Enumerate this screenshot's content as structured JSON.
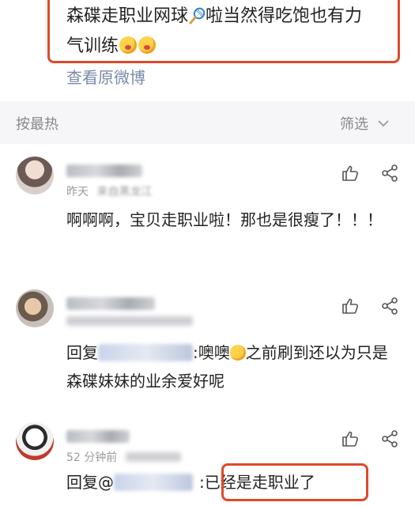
{
  "post": {
    "text_part1": "森碟走职业网球",
    "text_part2": "啦当然得吃饱也有力",
    "text_part3": "气训练",
    "racket_icon": "tennis-racket-icon",
    "emoji_icon": "drooling-face-icon"
  },
  "view_original": "查看原微博",
  "sort_bar": {
    "sort_label": "按最热",
    "filter_label": "筛选"
  },
  "comments": [
    {
      "meta_time": "昨天",
      "meta_suffix": "来自黑龙江",
      "text": "啊啊啊，宝贝走职业啦！那也是很瘦了！！！"
    },
    {
      "reply_prefix": "回复",
      "text_after": ":噢噢",
      "text_end": "之前刷到还以为只是森碟妹妹的业余爱好呢"
    },
    {
      "meta_time": "52 分钟前",
      "reply_prefix": "回复@",
      "text_after": ":已经是走职业了"
    }
  ],
  "colors": {
    "highlight": "#e0492a",
    "link": "#7a8aa6",
    "sort_bar_bg": "#f6f6f8"
  }
}
